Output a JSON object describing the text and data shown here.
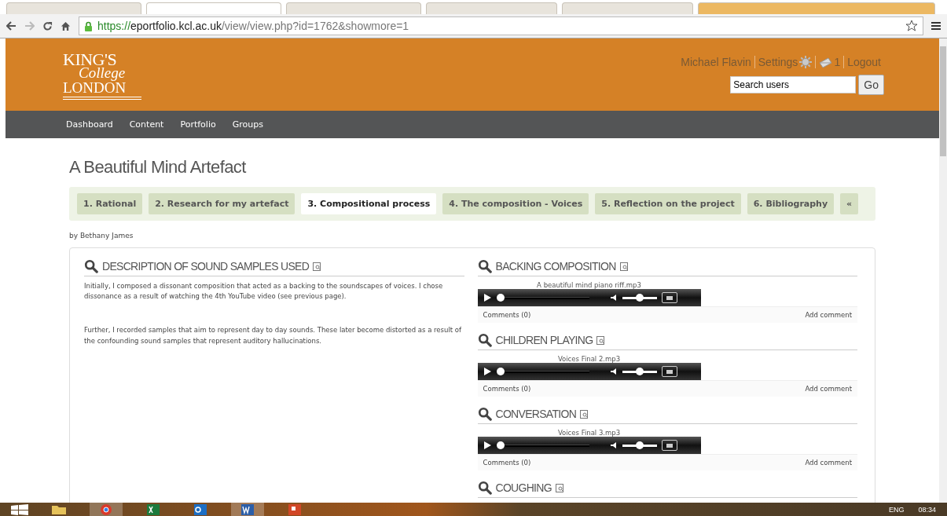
{
  "browser": {
    "url_secure": "https://",
    "url_host": "eportfolio.kcl.ac.uk",
    "url_path": "/view/view.php?id=1762&showmore=1"
  },
  "header": {
    "logo": {
      "line1": "KING'S",
      "line2": "College",
      "line3": "LONDON"
    },
    "user": "Michael Flavin",
    "settings": "Settings",
    "inbox_count": "1",
    "logout": "Logout",
    "search": {
      "placeholder": "Search users"
    },
    "go": "Go"
  },
  "nav": [
    "Dashboard",
    "Content",
    "Portfolio",
    "Groups"
  ],
  "page": {
    "title": "A Beautiful Mind Artefact",
    "author": "by Bethany James",
    "tabs": [
      {
        "label": "1. Rational",
        "selected": false
      },
      {
        "label": "2. Research for my artefact",
        "selected": false
      },
      {
        "label": "3. Compositional process",
        "selected": true
      },
      {
        "label": "4. The composition - Voices",
        "selected": false
      },
      {
        "label": "5. Reflection on the project",
        "selected": false
      },
      {
        "label": "6. Bibliography",
        "selected": false
      },
      {
        "label": "«",
        "selected": false
      }
    ]
  },
  "left_block": {
    "title": "DESCRIPTION OF SOUND SAMPLES USED",
    "paragraphs": [
      "Initially, I composed a dissonant composition that acted as a backing to the soundscapes of voices. I chose dissonance as a result of watching the 4th YouTube video (see previous page).",
      "Further, I recorded samples that aim to represent day to day sounds. These later become distorted as a result of the confounding sound samples that represent auditory hallucinations."
    ]
  },
  "audio_blocks": [
    {
      "title": "BACKING COMPOSITION",
      "file": "A beautiful mind piano riff.mp3",
      "seek": {
        "level": 0
      },
      "volume": {
        "level": 0.5
      },
      "comments": "Comments (0)",
      "add_comment": "Add comment"
    },
    {
      "title": "CHILDREN PLAYING",
      "file": "Voices Final 2.mp3",
      "seek": {
        "level": 0
      },
      "volume": {
        "level": 0.5
      },
      "comments": "Comments (0)",
      "add_comment": "Add comment"
    },
    {
      "title": "CONVERSATION",
      "file": "Voices Final 3.mp3",
      "seek": {
        "level": 0
      },
      "volume": {
        "level": 0.5
      },
      "comments": "Comments (0)",
      "add_comment": "Add comment"
    },
    {
      "title": "COUGHING"
    }
  ],
  "taskbar": {
    "language": "ENG",
    "clock": "08:34"
  }
}
